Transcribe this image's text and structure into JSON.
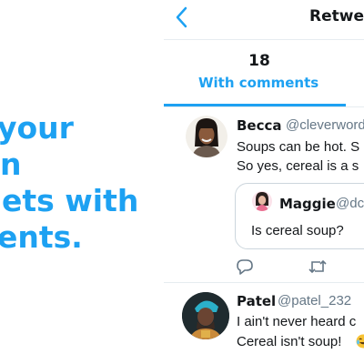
{
  "headline": {
    "lines": [
      "your",
      "n",
      "ets with",
      "ents."
    ]
  },
  "header": {
    "title": "Retweets",
    "back_icon": "chevron-left-icon"
  },
  "tab": {
    "count": "18",
    "label": "With comments"
  },
  "tweets": [
    {
      "name": "Becca",
      "handle": "@cleverwords",
      "lines": [
        "Soups can be hot. S",
        "So yes, cereal is a s"
      ],
      "quote": {
        "name": "Maggie",
        "handle": "@dc",
        "text": "Is cereal soup?"
      },
      "actions": [
        "reply-icon",
        "retweet-icon"
      ]
    },
    {
      "name": "Patel",
      "handle": "@patel_232",
      "lines": [
        "I ain't never heard c",
        "Cereal isn't soup!"
      ]
    }
  ],
  "colors": {
    "accent": "#1da1f2",
    "text": "#14171a",
    "muted": "#657786",
    "border": "#e6ecf0"
  }
}
